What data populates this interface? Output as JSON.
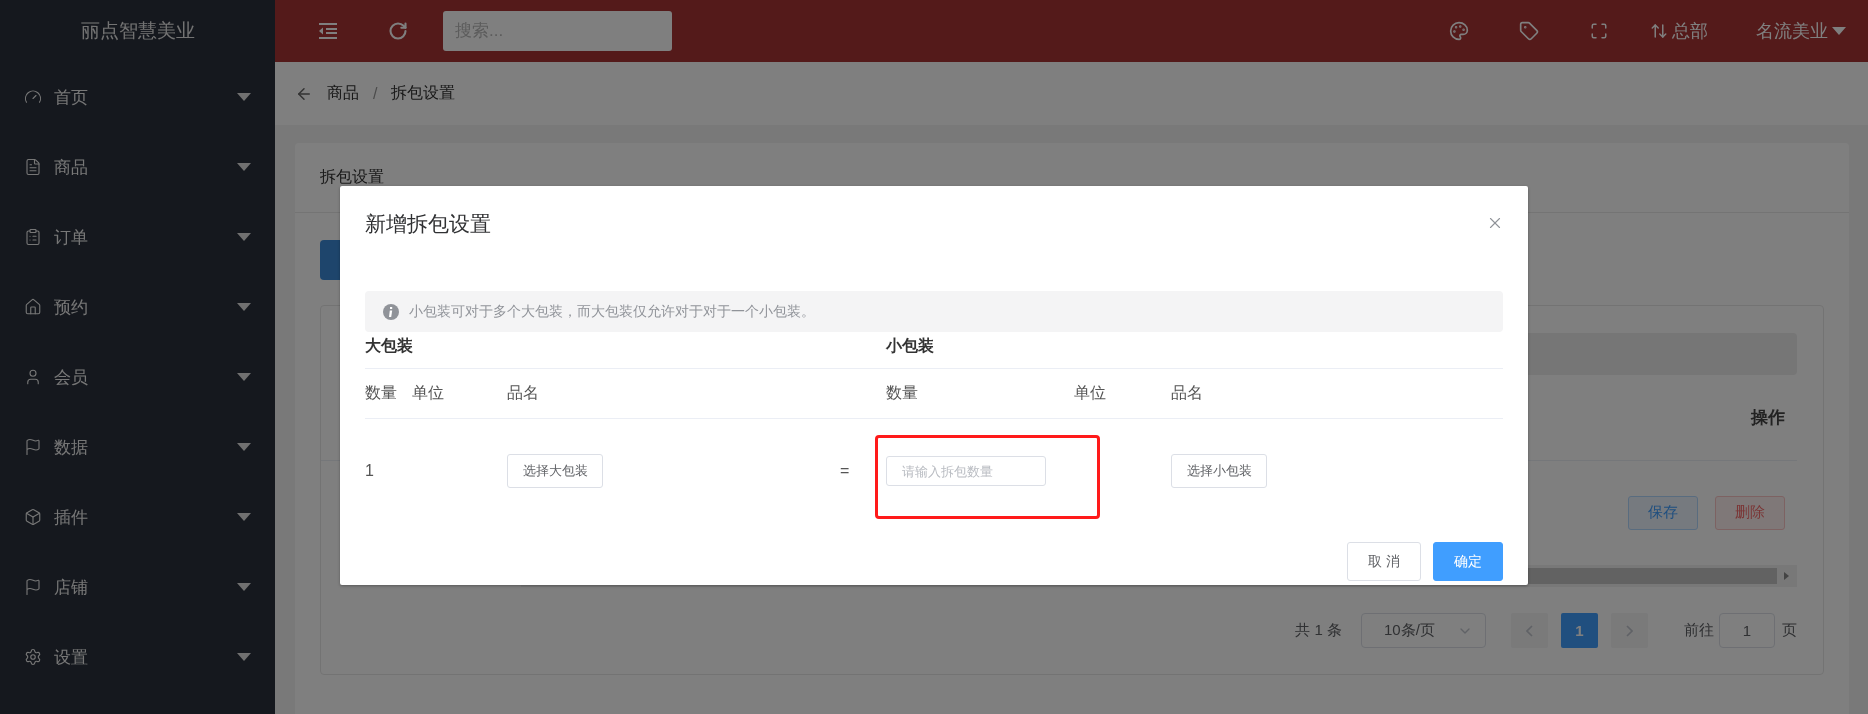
{
  "brand": "丽点智慧美业",
  "sidebar": {
    "items": [
      {
        "label": "首页"
      },
      {
        "label": "商品"
      },
      {
        "label": "订单"
      },
      {
        "label": "预约"
      },
      {
        "label": "会员"
      },
      {
        "label": "数据"
      },
      {
        "label": "插件"
      },
      {
        "label": "店铺"
      },
      {
        "label": "设置"
      }
    ]
  },
  "topbar": {
    "search": {
      "placeholder": "搜索..."
    },
    "branch": "总部",
    "user": "名流美业"
  },
  "breadcrumb": {
    "items": [
      "商品",
      "拆包设置"
    ],
    "separator": "/"
  },
  "page": {
    "card_title": "拆包设置",
    "table": {
      "action_header": "操作",
      "row_buttons": [
        {
          "label": "保存",
          "kind": "primary"
        },
        {
          "label": "删除",
          "kind": "danger"
        }
      ]
    },
    "pagination": {
      "total": "共 1 条",
      "page_size": "10条/页",
      "pages": [
        {
          "label": "1",
          "selected": true
        }
      ],
      "goto_label": "前往",
      "goto_value": "1",
      "goto_suffix": "页"
    }
  },
  "dialog": {
    "title": "新增拆包设置",
    "notice": "小包装可对于多个大包装，而大包装仅允许对于对于一个小包装。",
    "big": {
      "heading": "大包装",
      "columns": [
        "数量",
        "单位",
        "品名"
      ],
      "quantity": "1",
      "select_button": "选择大包装"
    },
    "equals": "=",
    "small": {
      "heading": "小包装",
      "columns": [
        "数量",
        "单位",
        "品名"
      ],
      "quantity_placeholder": "请输入拆包数量",
      "select_button": "选择小包装"
    },
    "cancel": "取 消",
    "confirm": "确定"
  }
}
